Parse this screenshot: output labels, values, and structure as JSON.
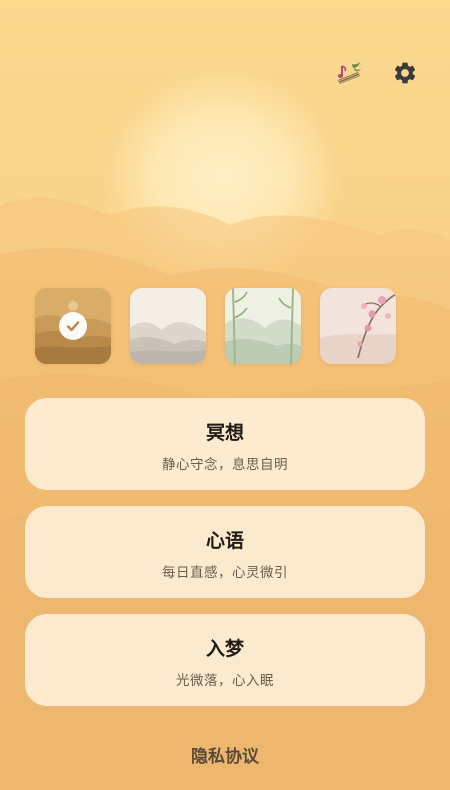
{
  "header": {
    "music_icon": "guzheng-music-icon",
    "settings_icon": "gear-icon"
  },
  "themes": [
    {
      "name": "sunset-mountains",
      "selected": true
    },
    {
      "name": "misty-mountains",
      "selected": false
    },
    {
      "name": "bamboo-mountains",
      "selected": false
    },
    {
      "name": "plum-blossom",
      "selected": false
    }
  ],
  "cards": [
    {
      "title": "冥想",
      "subtitle": "静心守念，息思自明"
    },
    {
      "title": "心语",
      "subtitle": "每日直感，心灵微引"
    },
    {
      "title": "入梦",
      "subtitle": "光微落，心入眠"
    }
  ],
  "footer": {
    "privacy_label": "隐私协议"
  },
  "colors": {
    "background": "#f6cf86",
    "card": "#fff5e4",
    "title_text": "#1f1a14",
    "subtitle_text": "#6a5d4e"
  }
}
